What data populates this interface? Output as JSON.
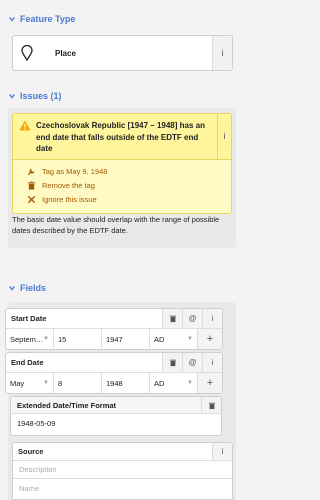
{
  "feature_type": {
    "header": "Feature Type",
    "name": "Place",
    "info": "i"
  },
  "issues": {
    "header": "Issues (1)",
    "message": "Czechoslovak Republic [1947 – 1948] has an end date that falls outside of the EDTF end date",
    "info": "i",
    "fixes": [
      {
        "label": "Tag as May 9, 1948",
        "icon": "wrench-icon"
      },
      {
        "label": "Remove the tag",
        "icon": "trash-icon"
      },
      {
        "label": "Ignore this issue",
        "icon": "close-icon"
      }
    ],
    "tip": "The basic date value should overlap with the range of possible dates described by the EDTF date."
  },
  "fields": {
    "header": "Fields",
    "start_date": {
      "label": "Start Date",
      "month": "Septem…",
      "day": "15",
      "year": "1947",
      "era": "AD"
    },
    "end_date": {
      "label": "End Date",
      "month": "May",
      "day": "8",
      "year": "1948",
      "era": "AD"
    },
    "edtf": {
      "label": "Extended Date/Time Format",
      "value": "1948-05-09"
    },
    "source": {
      "label": "Source",
      "description_placeholder": "Description",
      "name_placeholder": "Name"
    }
  },
  "colors": {
    "accent": "#4a7bd0",
    "warning_bg": "#fff9c4",
    "fix_text": "#a05a00"
  }
}
